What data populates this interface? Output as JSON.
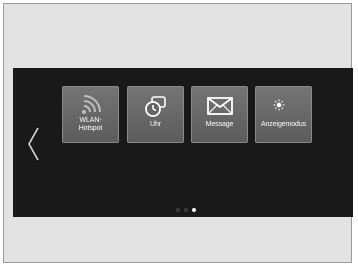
{
  "nav": {
    "back_icon": "chevron-left-icon"
  },
  "tiles": [
    {
      "label": "WLAN-\nHotspot",
      "icon": "wifi-icon"
    },
    {
      "label": "Uhr",
      "icon": "clock-icon"
    },
    {
      "label": "Message",
      "icon": "envelope-icon"
    },
    {
      "label": "Anzeigemodus",
      "icon": "sun-moon-icon"
    }
  ],
  "pager": {
    "pages": 3,
    "current": 3
  },
  "colors": {
    "screen": "#191919",
    "tile": "#646464",
    "text": "#ffffff",
    "frame": "#e3e3e3"
  }
}
